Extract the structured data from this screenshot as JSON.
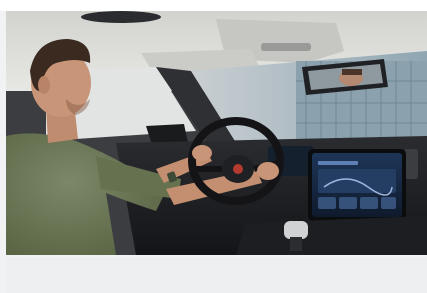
{
  "photo": {
    "subject": "driver-in-car-interior",
    "colors": {
      "headliner": "#d9d9d7",
      "shirt": "#6e7a5c",
      "skin": "#c89578",
      "hair": "#3a2a20",
      "dashboard": "#1c1d20",
      "screen": "#1a2a44",
      "window": "#aeb8bf",
      "building": "#7f98a6"
    }
  }
}
